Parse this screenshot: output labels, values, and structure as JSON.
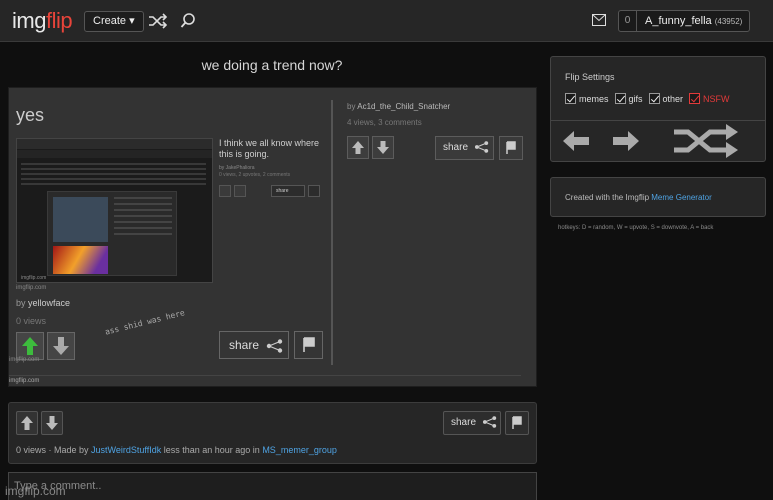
{
  "topbar": {
    "logo_part1": "img",
    "logo_part2": "flip",
    "create_label": "Create ▾",
    "notif_count": "0",
    "username": "A_funny_fella",
    "user_points": "(43952)"
  },
  "post": {
    "title": "we doing a trend now?",
    "share_label": "share",
    "meta_prefix": "0 views · Made by ",
    "author": "JustWeirdStuffIdk",
    "meta_mid": " less than an hour ago in ",
    "stream": "MS_memer_group",
    "comment_placeholder": "Type a comment..",
    "watermark": "imgflip.com"
  },
  "meme": {
    "yes_text": "yes",
    "quote": "I think we all know where this is going.",
    "quote_by": "by JakePhaliora",
    "quote_stats": "0 views, 2 upvotes, 2 comments",
    "mini_share": "share",
    "wm": "imgflip.com",
    "by_label": "by ",
    "by_user": "yellowface",
    "views": "0 views",
    "share_label": "share",
    "handwritten": "ass shid was here",
    "right_by_label": "by ",
    "right_by_user": "Ac1d_the_Child_Snatcher",
    "right_stats": "4 views, 3 comments",
    "right_share": "share"
  },
  "flip_settings": {
    "title": "Flip Settings",
    "options": [
      "memes",
      "gifs",
      "other",
      "NSFW"
    ]
  },
  "created": {
    "prefix": "Created with the Imgflip ",
    "link": "Meme Generator"
  },
  "hotkeys": "hotkeys: D = random, W = upvote, S = downvote, A = back",
  "colors": {
    "accent_red": "#e8443a",
    "link_blue": "#4fa3e3",
    "upvote_green": "#3dbb3d"
  }
}
